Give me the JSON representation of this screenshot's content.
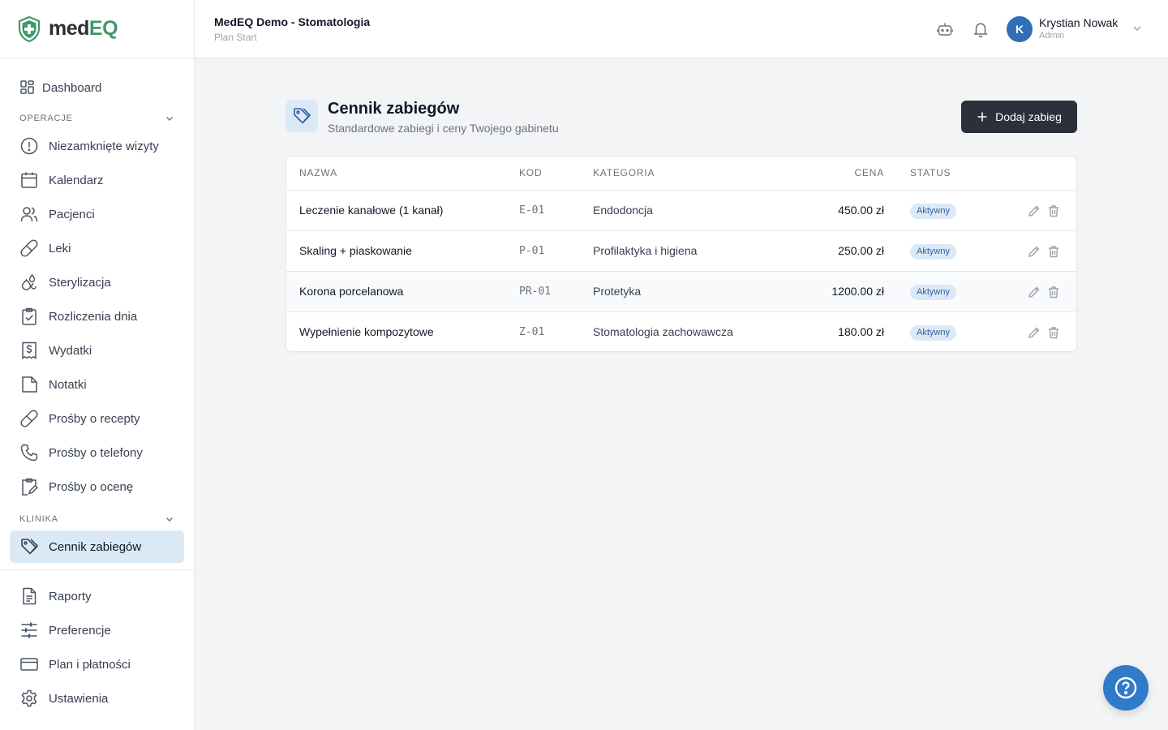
{
  "brand": {
    "part1": "med",
    "part2": "EQ",
    "green": "#3f9a6a"
  },
  "topbar": {
    "clinic_name": "MedEQ Demo - Stomatologia",
    "plan": "Plan Start",
    "user": {
      "initial": "K",
      "name": "Krystian Nowak",
      "role": "Admin"
    }
  },
  "sidebar": {
    "dashboard": "Dashboard",
    "section_operations": "OPERACJE",
    "operations": [
      {
        "label": "Niezamknięte wizyty",
        "icon": "alert-circle-icon"
      },
      {
        "label": "Kalendarz",
        "icon": "calendar-icon"
      },
      {
        "label": "Pacjenci",
        "icon": "users-icon"
      },
      {
        "label": "Leki",
        "icon": "pill-icon"
      },
      {
        "label": "Sterylizacja",
        "icon": "drops-icon"
      },
      {
        "label": "Rozliczenia dnia",
        "icon": "clipboard-check-icon"
      },
      {
        "label": "Wydatki",
        "icon": "receipt-dollar-icon"
      },
      {
        "label": "Notatki",
        "icon": "note-icon"
      },
      {
        "label": "Prośby o recepty",
        "icon": "pill-icon"
      },
      {
        "label": "Prośby o telefony",
        "icon": "phone-icon"
      },
      {
        "label": "Prośby o ocenę",
        "icon": "clipboard-edit-icon"
      }
    ],
    "section_clinic": "KLINIKA",
    "clinic": [
      {
        "label": "Cennik zabiegów",
        "icon": "tag-icon"
      }
    ],
    "bottom": [
      {
        "label": "Raporty",
        "icon": "file-text-icon"
      },
      {
        "label": "Preferencje",
        "icon": "sliders-icon"
      },
      {
        "label": "Plan i płatności",
        "icon": "credit-card-icon"
      },
      {
        "label": "Ustawienia",
        "icon": "gear-icon"
      }
    ]
  },
  "main": {
    "title": "Cennik zabiegów",
    "subtitle": "Standardowe zabiegi i ceny Twojego gabinetu",
    "add_button": "Dodaj zabieg",
    "table": {
      "headers": {
        "name": "NAZWA",
        "code": "KOD",
        "category": "KATEGORIA",
        "price": "CENA",
        "status": "STATUS"
      },
      "rows": [
        {
          "name": "Leczenie kanałowe (1 kanał)",
          "code": "E-01",
          "category": "Endodoncja",
          "price": "450.00 zł",
          "status": "Aktywny"
        },
        {
          "name": "Skaling + piaskowanie",
          "code": "P-01",
          "category": "Profilaktyka i higiena",
          "price": "250.00 zł",
          "status": "Aktywny"
        },
        {
          "name": "Korona porcelanowa",
          "code": "PR-01",
          "category": "Protetyka",
          "price": "1200.00 zł",
          "status": "Aktywny"
        },
        {
          "name": "Wypełnienie kompozytowe",
          "code": "Z-01",
          "category": "Stomatologia zachowawcza",
          "price": "180.00 zł",
          "status": "Aktywny"
        }
      ]
    }
  }
}
